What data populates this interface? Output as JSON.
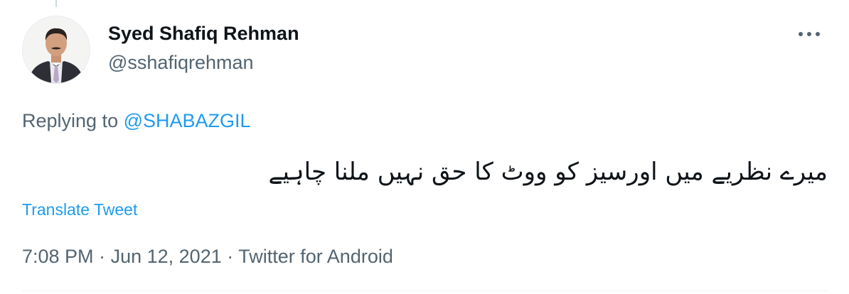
{
  "tweet": {
    "author": {
      "display_name": "Syed Shafiq Rehman",
      "handle": "@sshafiqrehman",
      "avatar_icon": "avatar-photo"
    },
    "more_icon": "more-horizontal-icon",
    "replying_prefix": "Replying to",
    "replying_to": "@SHABAZGIL",
    "text": "میرے نظریے میں اورسیز کو ووٹ کا حق نہیں ملنا چاہیے",
    "translate_label": "Translate Tweet",
    "time": "7:08 PM",
    "date": "Jun 12, 2021",
    "separator": "·",
    "source": "Twitter for Android"
  },
  "colors": {
    "accent": "#1d9bf0",
    "secondary_text": "#536471",
    "primary_text": "#0f1419"
  }
}
